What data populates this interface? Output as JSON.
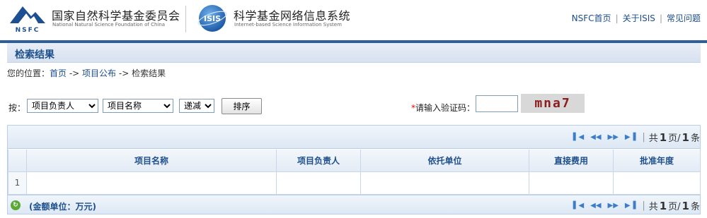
{
  "header": {
    "org_name_cn": "国家自然科学基金委员会",
    "org_name_en": "National Natural Science Foundation of China",
    "org_logo_text": "NSFC",
    "system_logo_text": "ISIS",
    "system_name_cn": "科学基金网络信息系统",
    "system_name_en": "Internet-based Science Information System",
    "links": [
      "NSFC首页",
      "关于ISIS",
      "常见问题"
    ]
  },
  "page_title": "检索结果",
  "breadcrumb": {
    "prefix": "您的位置：",
    "items": [
      "首页",
      "项目公布",
      "检索结果"
    ],
    "separator": " -> "
  },
  "sort": {
    "label": "按：",
    "field1": "项目负责人",
    "field2": "项目名称",
    "order": "递减",
    "button": "排序"
  },
  "captcha": {
    "required_mark": "*",
    "label": "请输入验证码：",
    "value": "",
    "image_text": "mna7"
  },
  "pager": {
    "prefix": "共",
    "current": "1",
    "middle": "页/",
    "total": "1",
    "suffix": "条"
  },
  "table": {
    "columns": [
      "",
      "项目名称",
      "项目负责人",
      "依托单位",
      "直接费用",
      "批准年度"
    ],
    "rows": [
      [
        "1",
        "",
        "",
        "",
        "",
        ""
      ]
    ]
  },
  "footer": {
    "unit_note": "(金额单位：万元)"
  },
  "colors": {
    "brand_blue": "#2d5f9e",
    "link": "#1a4c8a",
    "header_text": "#1d4f8c",
    "required": "#e00000"
  }
}
